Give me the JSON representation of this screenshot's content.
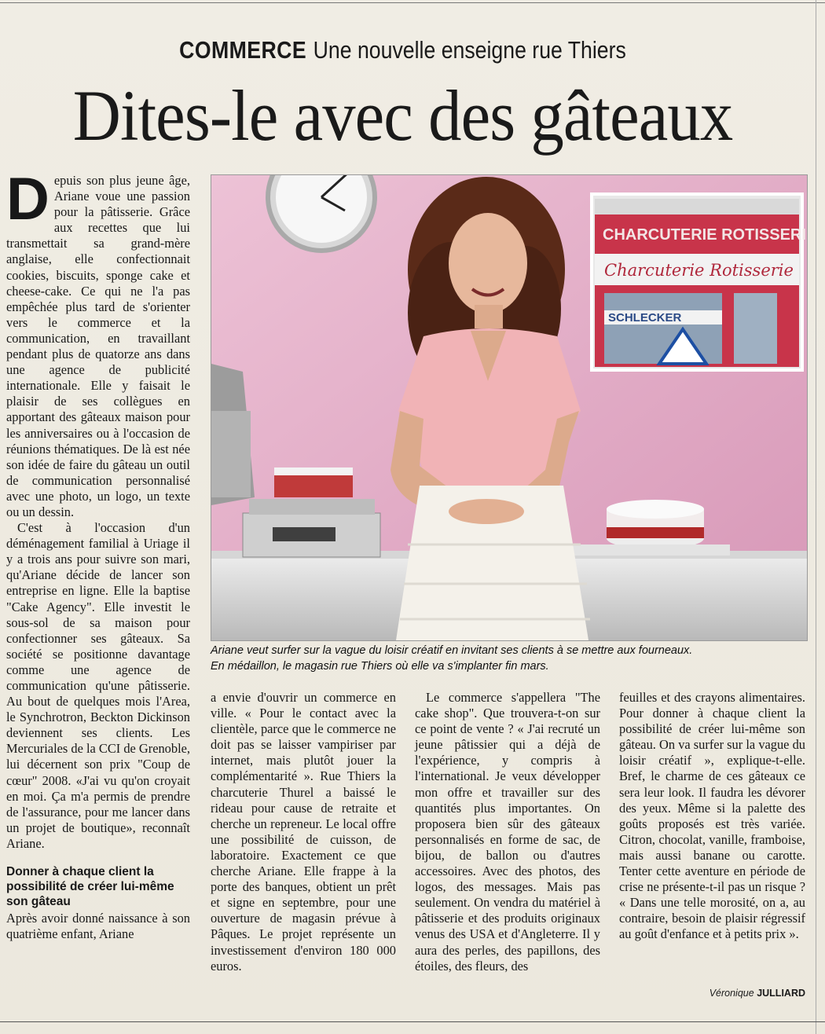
{
  "kicker": {
    "rubric": "COMMERCE",
    "title": "Une nouvelle enseigne rue Thiers"
  },
  "headline": "Dites-le avec des gâteaux",
  "dropcap": "D",
  "col1": {
    "p1": "epuis son plus jeune âge, Ariane voue une passion pour la pâtisserie. Grâce aux recettes que lui transmettait sa grand-mère anglaise, elle confectionnait cookies, biscuits, sponge cake et cheese-cake. Ce qui ne l'a pas empêchée plus tard de s'orienter vers le commerce et la communication, en travaillant pendant plus de quatorze ans dans une agence de publicité internationale. Elle y faisait le plaisir de ses collègues en apportant des gâteaux maison pour les anniversaires ou à l'occasion de réunions thématiques. De là est née son idée de faire du gâteau un outil de communication personnalisé avec une photo, un logo, un texte ou un dessin.",
    "p2": "C'est à l'occasion d'un déménagement familial à Uriage il y a trois ans pour suivre son mari, qu'Ariane décide de lancer son entreprise en ligne. Elle la baptise \"Cake Agency\". Elle investit le sous-sol de sa maison pour confectionner ses gâteaux. Sa société se positionne davantage comme une agence de communication qu'une pâtisserie. Au bout de quelques mois l'Area, le Synchrotron, Beckton Dickinson deviennent ses clients. Les Mercuriales de la CCI de Grenoble, lui décernent son prix \"Coup de cœur\" 2008. «J'ai vu qu'on croyait en moi. Ça m'a permis de prendre de l'assurance, pour me lancer dans un projet de boutique», reconnaît Ariane.",
    "subhead": "Donner à chaque client la possibilité de créer lui-même son gâteau",
    "p3": "Après avoir donné naissance à son quatrième enfant, Ariane"
  },
  "col2": {
    "p1": "a envie d'ouvrir un commerce en ville. « Pour le contact avec la clientèle, parce que le commerce ne doit pas se laisser vampiriser par internet, mais plutôt jouer la complémentarité ». Rue Thiers la charcuterie Thurel a baissé le rideau pour cause de retraite et cherche un repreneur. Le local offre une possibilité de cuisson, de laboratoire. Exactement ce que cherche Ariane. Elle frappe à la porte des banques, obtient un prêt et signe en septembre, pour une ouverture de magasin prévue à Pâques. Le projet représente un investissement d'environ 180 000 euros."
  },
  "col3": {
    "p1": "Le commerce s'appellera \"The cake shop\". Que trouvera-t-on sur ce point de vente ? « J'ai recruté un jeune pâtissier qui a déjà de l'expérience, y compris à l'international. Je veux développer mon offre et travailler sur des quantités plus importantes. On proposera bien sûr des gâteaux personnalisés en forme de sac, de bijou, de ballon ou d'autres accessoires. Avec des photos, des logos, des messages. Mais pas seulement. On vendra du matériel à pâtisserie et des produits originaux venus des USA et d'Angleterre. Il y aura des perles, des papillons, des étoiles, des fleurs, des"
  },
  "col4": {
    "p1": "feuilles et des crayons alimentaires. Pour donner à chaque client la possibilité de créer lui-même son gâteau. On va surfer sur la vague du loisir créatif », explique-t-elle. Bref, le charme de ces gâteaux ce sera leur look. Il faudra les dévorer des yeux. Même si la palette des goûts proposés est très variée. Citron, chocolat, vanille, framboise, mais aussi banane ou carotte. Tenter cette aventure en période de crise ne présente-t-il pas un risque ? « Dans une telle morosité, on a, au contraire, besoin de plaisir régressif au goût d'enfance et à petits prix »."
  },
  "caption": {
    "line1": "Ariane veut surfer sur la vague du loisir créatif en invitant ses clients à se mettre aux fourneaux.",
    "line2": "En médaillon, le magasin rue Thiers où elle va s'implanter fin mars."
  },
  "shop_sign": {
    "top": "CHARCUTERIE ROTISSERIE",
    "script": "Charcuterie Rotisserie",
    "window": "SCHLECKER"
  },
  "byline": {
    "first": "Véronique",
    "last": "JULLIARD"
  },
  "colors": {
    "wall": "#e3a8c3",
    "blouse": "#f0b3b7",
    "skirt": "#f4f1ea",
    "shopfront": "#c8344a"
  }
}
